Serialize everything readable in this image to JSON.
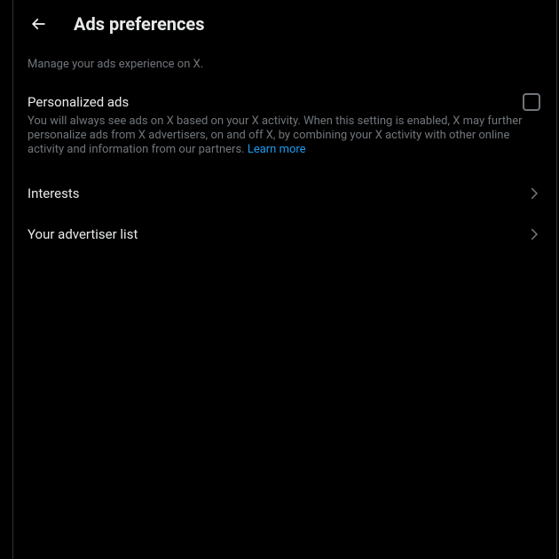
{
  "header": {
    "title": "Ads preferences"
  },
  "subtitle": "Manage your ads experience on X.",
  "personalized": {
    "label": "Personalized ads",
    "description": "You will always see ads on X based on your X activity. When this setting is enabled, X may further personalize ads from X advertisers, on and off X, by combining your X activity with other online activity and information from our partners. ",
    "learn_more": "Learn more",
    "checked": false
  },
  "nav": {
    "interests": "Interests",
    "advertiser_list": "Your advertiser list"
  }
}
